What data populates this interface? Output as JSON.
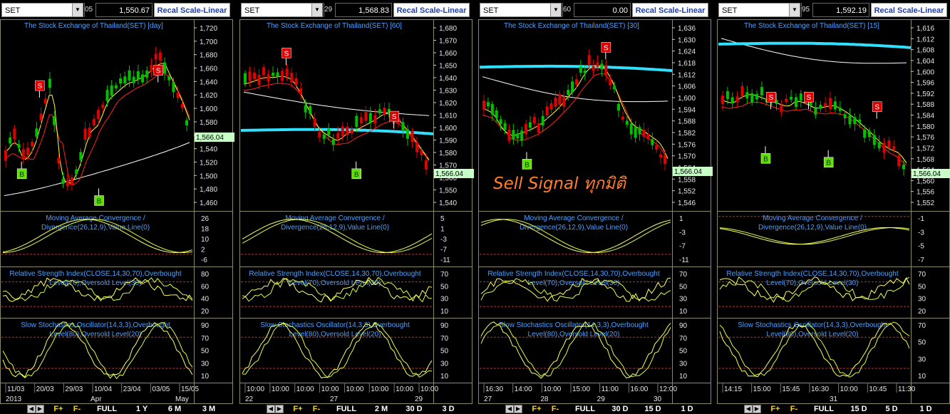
{
  "panels": [
    {
      "symbol": "SET",
      "count": "05",
      "price": "1,550.67",
      "scale_label": "Recal Scale-Linear",
      "title": "The Stock Exchange of Thailand(SET) [day]",
      "last": "1,566.04",
      "y_ticks": [
        "1,720",
        "1,700",
        "1,680",
        "1,660",
        "1,640",
        "1,620",
        "1,600",
        "1,580",
        "1,560",
        "1,540",
        "1,520",
        "1,500",
        "1,480",
        "1,460"
      ],
      "signals": [
        {
          "t": "S",
          "x": 0.18,
          "y": 0.32
        },
        {
          "t": "S",
          "x": 0.84,
          "y": 0.24
        },
        {
          "t": "B",
          "x": 0.08,
          "y": 0.78
        },
        {
          "t": "B",
          "x": 0.51,
          "y": 0.92
        }
      ],
      "macd_title": [
        "Moving Average Convergence /",
        "Divergence(26,12,9),Value Line(0)"
      ],
      "macd_ticks": [
        "26",
        "18",
        "10",
        "2",
        "-6"
      ],
      "rsi_title": [
        "Relative Strength Index(CLOSE,14,30,70),Overbought",
        "Level(70),Oversold Level(30)"
      ],
      "rsi_ticks": [
        "80",
        "60",
        "40",
        "20"
      ],
      "sto_title": [
        "Slow Stochastics Oscillator(14,3,3),Overbought",
        "Level(80),Oversold Level(20)"
      ],
      "sto_ticks": [
        "90",
        "70",
        "50",
        "30",
        "10"
      ],
      "x_labels": [
        "11/03",
        "20/03",
        "29/03",
        "10/04",
        "23/04",
        "03/05",
        "15/05"
      ],
      "x_labels2": [
        "2013",
        "Apr",
        "May"
      ],
      "buttons": [
        "F+",
        "F-",
        "FULL",
        "1 Y",
        "6 M",
        "3 M"
      ]
    },
    {
      "symbol": "SET",
      "count": "29",
      "price": "1,568.83",
      "scale_label": "Recal Scale-Linear",
      "title": "The Stock Exchange of Thailand(SET) [60]",
      "last": "1,566.04",
      "y_ticks": [
        "1,680",
        "1,670",
        "1,660",
        "1,650",
        "1,640",
        "1,630",
        "1,620",
        "1,610",
        "1,600",
        "1,590",
        "1,580",
        "1,570",
        "1,560",
        "1,550",
        "1,540"
      ],
      "signals": [
        {
          "t": "S",
          "x": 0.22,
          "y": 0.15
        },
        {
          "t": "S",
          "x": 0.82,
          "y": 0.48
        },
        {
          "t": "B",
          "x": 0.61,
          "y": 0.78
        }
      ],
      "macd_title": [
        "Moving Average Convergence /",
        "Divergence(26,12,9),Value Line(0)"
      ],
      "macd_ticks": [
        "5",
        "1",
        "-3",
        "-7",
        "-11"
      ],
      "rsi_title": [
        "Relative Strength Index(CLOSE,14,30,70),Overbought",
        "Level(70),Oversold Level(30)"
      ],
      "rsi_ticks": [
        "70",
        "50",
        "30",
        "10"
      ],
      "sto_title": [
        "Slow Stochastics Oscillator(14,3,3),Overbought",
        "Level(80),Oversold Level(20)"
      ],
      "sto_ticks": [
        "90",
        "70",
        "50",
        "30",
        "10"
      ],
      "x_labels": [
        "10:00",
        "10:00",
        "10:00",
        "10:00",
        "10:00",
        "10:00",
        "10:00",
        "10:00"
      ],
      "x_labels2": [
        "22",
        "27",
        "29"
      ],
      "buttons": [
        "F+",
        "F-",
        "FULL",
        "2 M",
        "30 D",
        "3 D"
      ]
    },
    {
      "symbol": "SET",
      "count": "60",
      "price": "0.00",
      "scale_label": "Recal Scale-Linear",
      "title": "The Stock Exchange of Thailand(SET) [30]",
      "last": "1,566.04",
      "y_ticks": [
        "1,636",
        "1,630",
        "1,624",
        "1,618",
        "1,612",
        "1,606",
        "1,600",
        "1,594",
        "1,588",
        "1,582",
        "1,576",
        "1,570",
        "1,564",
        "1,558",
        "1,552",
        "1,546"
      ],
      "signals": [
        {
          "t": "S",
          "x": 0.67,
          "y": 0.12
        },
        {
          "t": "B",
          "x": 0.23,
          "y": 0.73
        }
      ],
      "macd_title": [
        "Moving Average Convergence /",
        "Divergence(26,12,9),Value Line(0)"
      ],
      "macd_ticks": [
        "1",
        "-3",
        "-7",
        "-11"
      ],
      "rsi_title": [
        "Relative Strength Index(CLOSE,14,30,70),Overbought",
        "Level(70),Oversold Level(30)"
      ],
      "rsi_ticks": [
        "70",
        "50",
        "30",
        "10"
      ],
      "sto_title": [
        "Slow Stochastics Oscillator(14,3,3),Overbought",
        "Level(80),Oversold Level(20)"
      ],
      "sto_ticks": [
        "90",
        "70",
        "50",
        "30",
        "10"
      ],
      "x_labels": [
        "16:30",
        "14:00",
        "10:00",
        "15:00",
        "11:00",
        "16:00",
        "12:00"
      ],
      "x_labels2": [
        "27",
        "28",
        "29",
        "30"
      ],
      "buttons": [
        "F+",
        "F-",
        "FULL",
        "30 D",
        "15 D",
        "1 D"
      ]
    },
    {
      "symbol": "SET",
      "count": "95",
      "price": "1,592.19",
      "scale_label": "Recal Scale-Linear",
      "title": "The Stock Exchange of Thailand(SET) [15]",
      "last": "1,566.04",
      "y_ticks": [
        "1,616",
        "1,612",
        "1,608",
        "1,604",
        "1,600",
        "1,596",
        "1,592",
        "1,588",
        "1,584",
        "1,580",
        "1,576",
        "1,572",
        "1,568",
        "1,564",
        "1,560",
        "1,556",
        "1,552"
      ],
      "signals": [
        {
          "t": "S",
          "x": 0.26,
          "y": 0.38
        },
        {
          "t": "S",
          "x": 0.47,
          "y": 0.38
        },
        {
          "t": "S",
          "x": 0.85,
          "y": 0.43
        },
        {
          "t": "B",
          "x": 0.23,
          "y": 0.7
        },
        {
          "t": "B",
          "x": 0.58,
          "y": 0.72
        }
      ],
      "macd_title": [
        "Moving Average Convergence /",
        "Divergence(26,12,9),Value Line(0)"
      ],
      "macd_ticks": [
        "-1",
        "-3",
        "-5",
        "-7"
      ],
      "rsi_title": [
        "Relative Strength Index(CLOSE,14,30,70),Overbought",
        "Level(70),Oversold Level(30)"
      ],
      "rsi_ticks": [
        "70",
        "50",
        "30",
        "20"
      ],
      "sto_title": [
        "Slow Stochastics Oscillator(14,3,3),Overbought",
        "Level(80),Oversold Level(20)"
      ],
      "sto_ticks": [
        "70",
        "50",
        "30",
        "10"
      ],
      "x_labels": [
        "14:15",
        "15:00",
        "15:45",
        "16:30",
        "10:00",
        "10:45",
        "11:30"
      ],
      "x_labels2": [
        "31"
      ],
      "buttons": [
        "F+",
        "F-",
        "FULL",
        "15 D",
        "5 D",
        "1 D"
      ]
    }
  ],
  "annotation": "Sell Signal ทุกมิติ",
  "colors": {
    "candle_up": "#00c000",
    "candle_down": "#e00000",
    "ma_white": "#ffffff",
    "ma_yellow": "#ffff40",
    "ma_red": "#ff2020",
    "ma_cyan": "#30e0ff",
    "title_blue": "#4aa0ff",
    "grid_red": "#c03030",
    "last_box": "#c8ffc8",
    "signal_sell": "#e00000",
    "signal_buy": "#60e000",
    "annotation": "#ff7e2a"
  },
  "chart_data": [
    {
      "type": "candlestick",
      "title": "The Stock Exchange of Thailand(SET) [day]",
      "last_price": 1566.04,
      "ylim": [
        1450,
        1725
      ]
    },
    {
      "type": "candlestick",
      "title": "The Stock Exchange of Thailand(SET) [60]",
      "last_price": 1566.04,
      "ylim": [
        1535,
        1685
      ]
    },
    {
      "type": "candlestick",
      "title": "The Stock Exchange of Thailand(SET) [30]",
      "last_price": 1566.04,
      "ylim": [
        1543,
        1640
      ]
    },
    {
      "type": "candlestick",
      "title": "The Stock Exchange of Thailand(SET) [15]",
      "last_price": 1566.04,
      "ylim": [
        1550,
        1618
      ]
    }
  ]
}
